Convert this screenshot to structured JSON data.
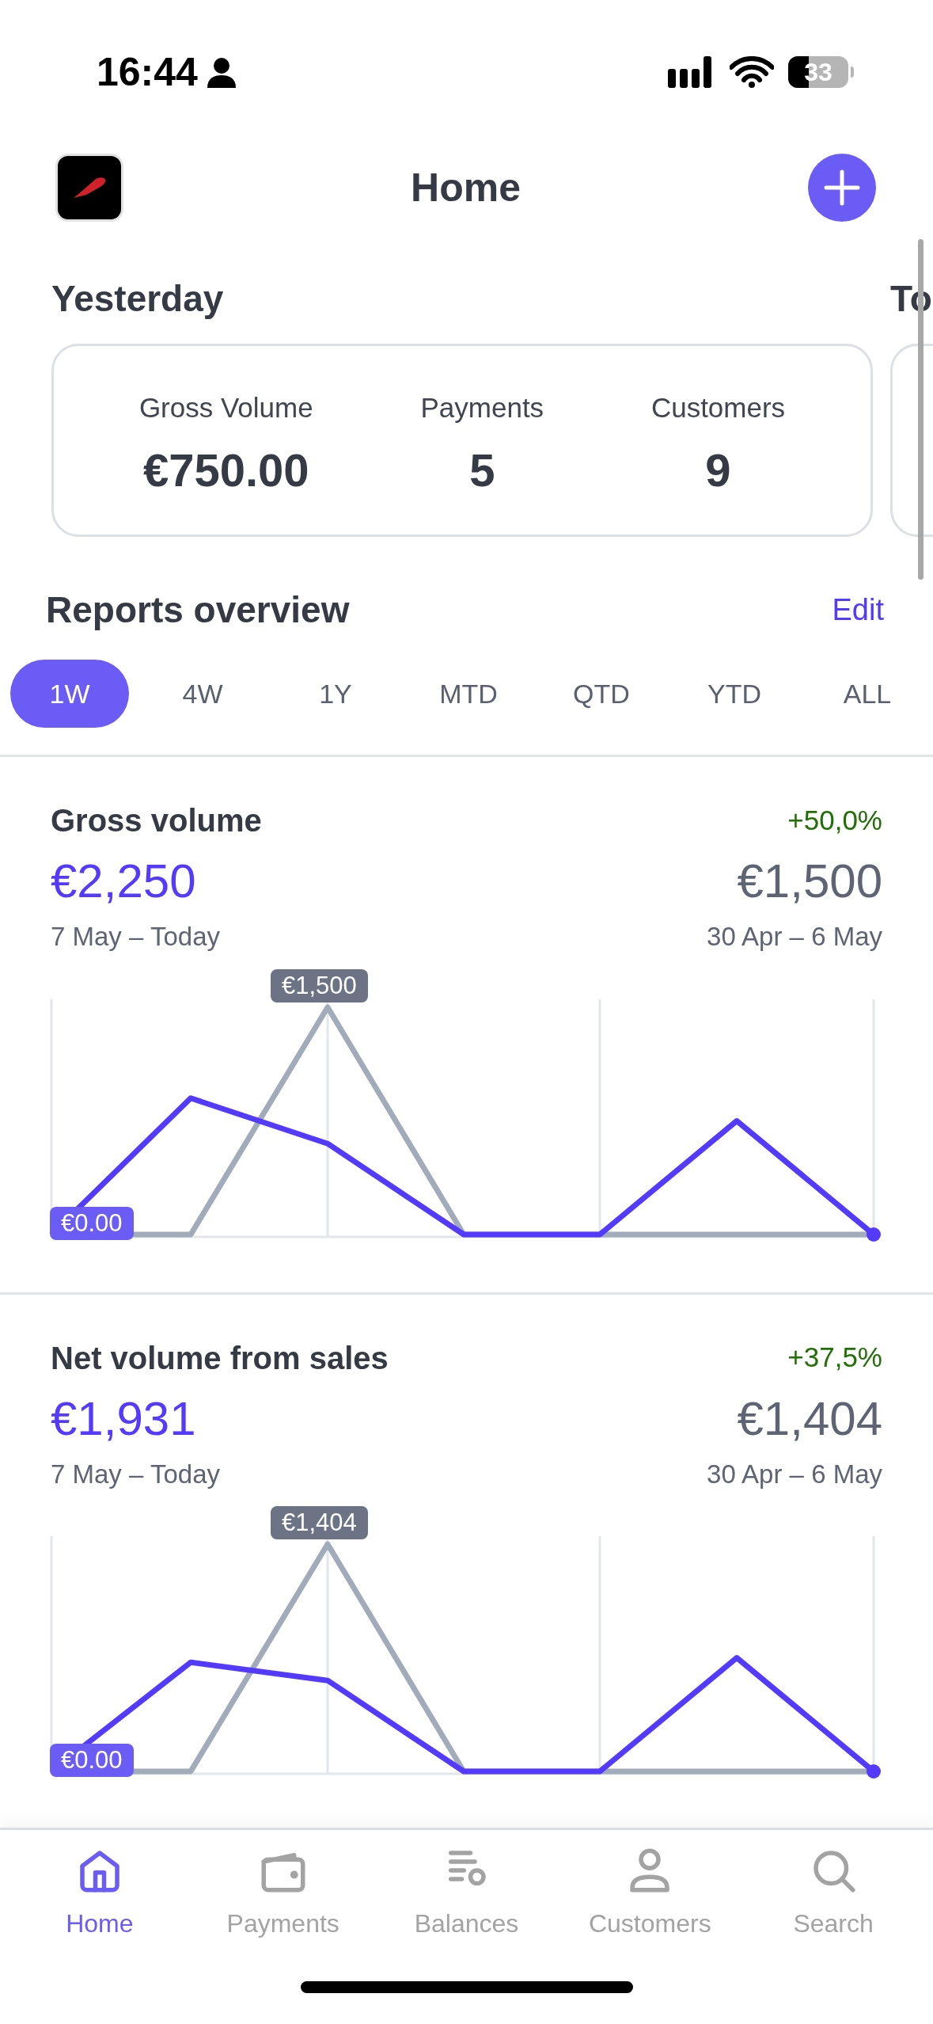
{
  "status_bar": {
    "time": "16:44",
    "battery": "33"
  },
  "header": {
    "title": "Home"
  },
  "summaries": [
    {
      "heading": "Yesterday",
      "metrics": [
        {
          "label": "Gross Volume",
          "value": "€750.00"
        },
        {
          "label": "Payments",
          "value": "5"
        },
        {
          "label": "Customers",
          "value": "9"
        }
      ]
    },
    {
      "heading": "To"
    }
  ],
  "reports": {
    "title": "Reports overview",
    "edit": "Edit",
    "ranges": [
      {
        "label": "1W",
        "selected": true
      },
      {
        "label": "4W",
        "selected": false
      },
      {
        "label": "1Y",
        "selected": false
      },
      {
        "label": "MTD",
        "selected": false
      },
      {
        "label": "QTD",
        "selected": false
      },
      {
        "label": "YTD",
        "selected": false
      },
      {
        "label": "ALL",
        "selected": false
      }
    ],
    "cards": [
      {
        "title": "Gross volume",
        "change": "+50,0%",
        "current": "€2,250",
        "current_period": "7 May – Today",
        "previous": "€1,500",
        "previous_period": "30 Apr – 6 May",
        "peak_label": "€1,500",
        "start_label": "€0.00"
      },
      {
        "title": "Net volume from sales",
        "change": "+37,5%",
        "current": "€1,931",
        "current_period": "7 May – Today",
        "previous": "€1,404",
        "previous_period": "30 Apr – 6 May",
        "peak_label": "€1,404",
        "start_label": "€0.00"
      }
    ]
  },
  "tab_bar": [
    {
      "label": "Home",
      "selected": true
    },
    {
      "label": "Payments",
      "selected": false
    },
    {
      "label": "Balances",
      "selected": false
    },
    {
      "label": "Customers",
      "selected": false
    },
    {
      "label": "Search",
      "selected": false
    }
  ]
}
